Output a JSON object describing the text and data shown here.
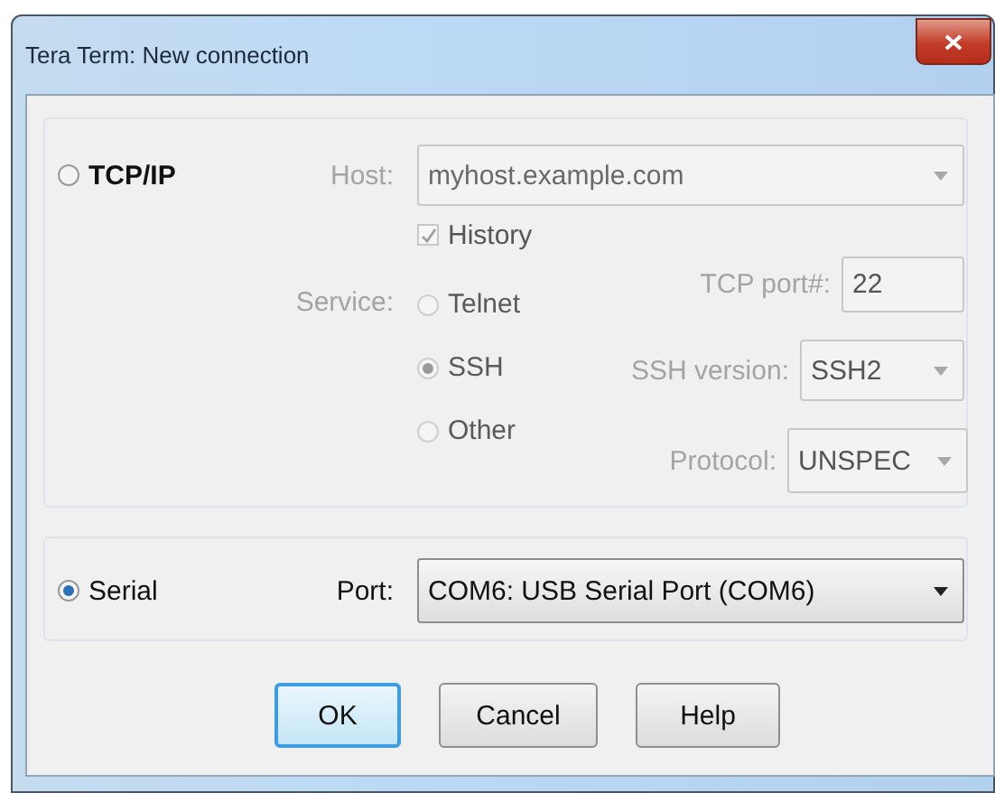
{
  "window": {
    "title": "Tera Term: New connection"
  },
  "tcpip": {
    "label": "TCP/IP",
    "selected": false,
    "disabled": true,
    "host": {
      "label": "Host:",
      "value": "myhost.example.com"
    },
    "history": {
      "label": "History",
      "checked": true
    },
    "service": {
      "label": "Service:",
      "options": [
        {
          "label": "Telnet",
          "selected": false
        },
        {
          "label": "SSH",
          "selected": true
        },
        {
          "label": "Other",
          "selected": false
        }
      ]
    },
    "settings": [
      {
        "kind": "field",
        "label": "TCP port#:",
        "value": "22"
      },
      {
        "kind": "select",
        "label": "SSH version:",
        "value": "SSH2"
      },
      {
        "kind": "select",
        "label": "Protocol:",
        "value": "UNSPEC"
      }
    ]
  },
  "serial": {
    "label": "Serial",
    "selected": true,
    "disabled": false,
    "port": {
      "label": "Port:",
      "value": "COM6: USB Serial Port (COM6)"
    }
  },
  "buttons": [
    {
      "label": "OK",
      "default": true
    },
    {
      "label": "Cancel",
      "default": false
    },
    {
      "label": "Help",
      "default": false
    }
  ]
}
